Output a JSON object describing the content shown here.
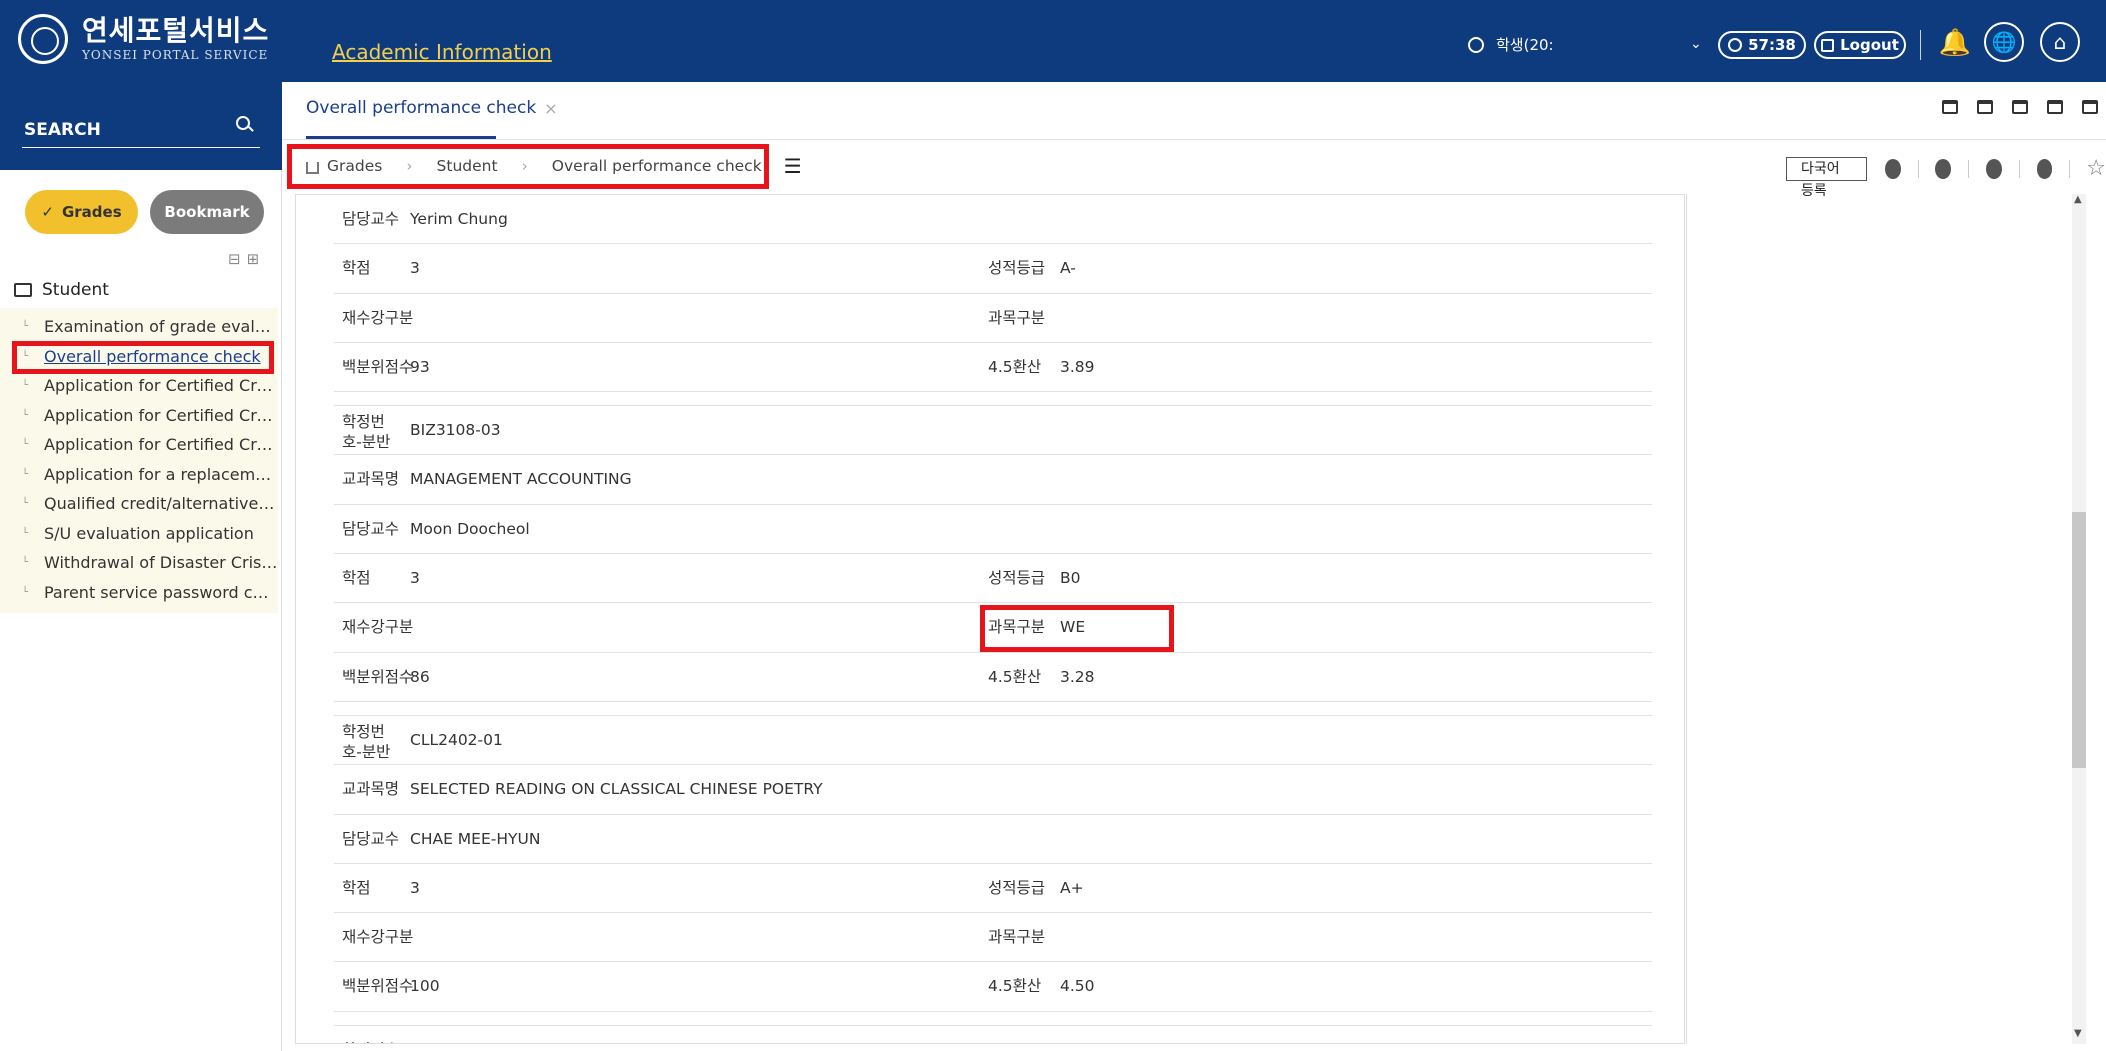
{
  "header": {
    "logo_kr": "연세포털서비스",
    "logo_en": "YONSEI PORTAL SERVICE",
    "app_title": "Academic Information",
    "user_label": "학생(20:",
    "timer": "57:38",
    "logout_label": "Logout"
  },
  "sidebar": {
    "search_label": "SEARCH",
    "chip_grades": "Grades",
    "chip_bookmark": "Bookmark",
    "root_label": "Student",
    "items": [
      "Examination of grade evalua…",
      "Overall performance check",
      "Application for Certified Credit",
      "Application for Certified Cre…",
      "Application for Certified Cre…",
      "Application for a replaceme…",
      "Qualified credit/alternative …",
      "S/U evaluation application",
      "Withdrawal of Disaster Crisis…",
      "Parent service password cha…"
    ]
  },
  "tab": {
    "label": "Overall performance check",
    "close": "×"
  },
  "breadcrumb": {
    "home": "Grades",
    "level2": "Student",
    "level3": "Overall performance check"
  },
  "toolbar": {
    "lang_button": "다국어등록"
  },
  "rows": [
    {
      "lbl": "담당교수",
      "val": "Yerim Chung"
    },
    {
      "lbl": "학점",
      "val": "3",
      "lbl2": "성적등급",
      "val2": "A-"
    },
    {
      "lbl": "재수강구분",
      "val": "",
      "lbl2": "과목구분",
      "val2": ""
    },
    {
      "lbl": "백분위점수",
      "val": "93",
      "lbl2": "4.5환산",
      "val2": "3.89"
    },
    {
      "lbl": "학정번호-분반",
      "val": "BIZ3108-03"
    },
    {
      "lbl": "교과목명",
      "val": "MANAGEMENT ACCOUNTING"
    },
    {
      "lbl": "담당교수",
      "val": "Moon Doocheol"
    },
    {
      "lbl": "학점",
      "val": "3",
      "lbl2": "성적등급",
      "val2": "B0"
    },
    {
      "lbl": "재수강구분",
      "val": "",
      "lbl2": "과목구분",
      "val2": "WE"
    },
    {
      "lbl": "백분위점수",
      "val": "86",
      "lbl2": "4.5환산",
      "val2": "3.28"
    },
    {
      "lbl": "학정번호-분반",
      "val": "CLL2402-01"
    },
    {
      "lbl": "교과목명",
      "val": "SELECTED READING ON CLASSICAL CHINESE POETRY"
    },
    {
      "lbl": "담당교수",
      "val": "CHAE MEE-HYUN"
    },
    {
      "lbl": "학점",
      "val": "3",
      "lbl2": "성적등급",
      "val2": "A+"
    },
    {
      "lbl": "재수강구분",
      "val": "",
      "lbl2": "과목구분",
      "val2": ""
    },
    {
      "lbl": "백분위점수",
      "val": "100",
      "lbl2": "4.5환산",
      "val2": "4.50"
    },
    {
      "lbl": "학정번호-",
      "val": ""
    }
  ]
}
